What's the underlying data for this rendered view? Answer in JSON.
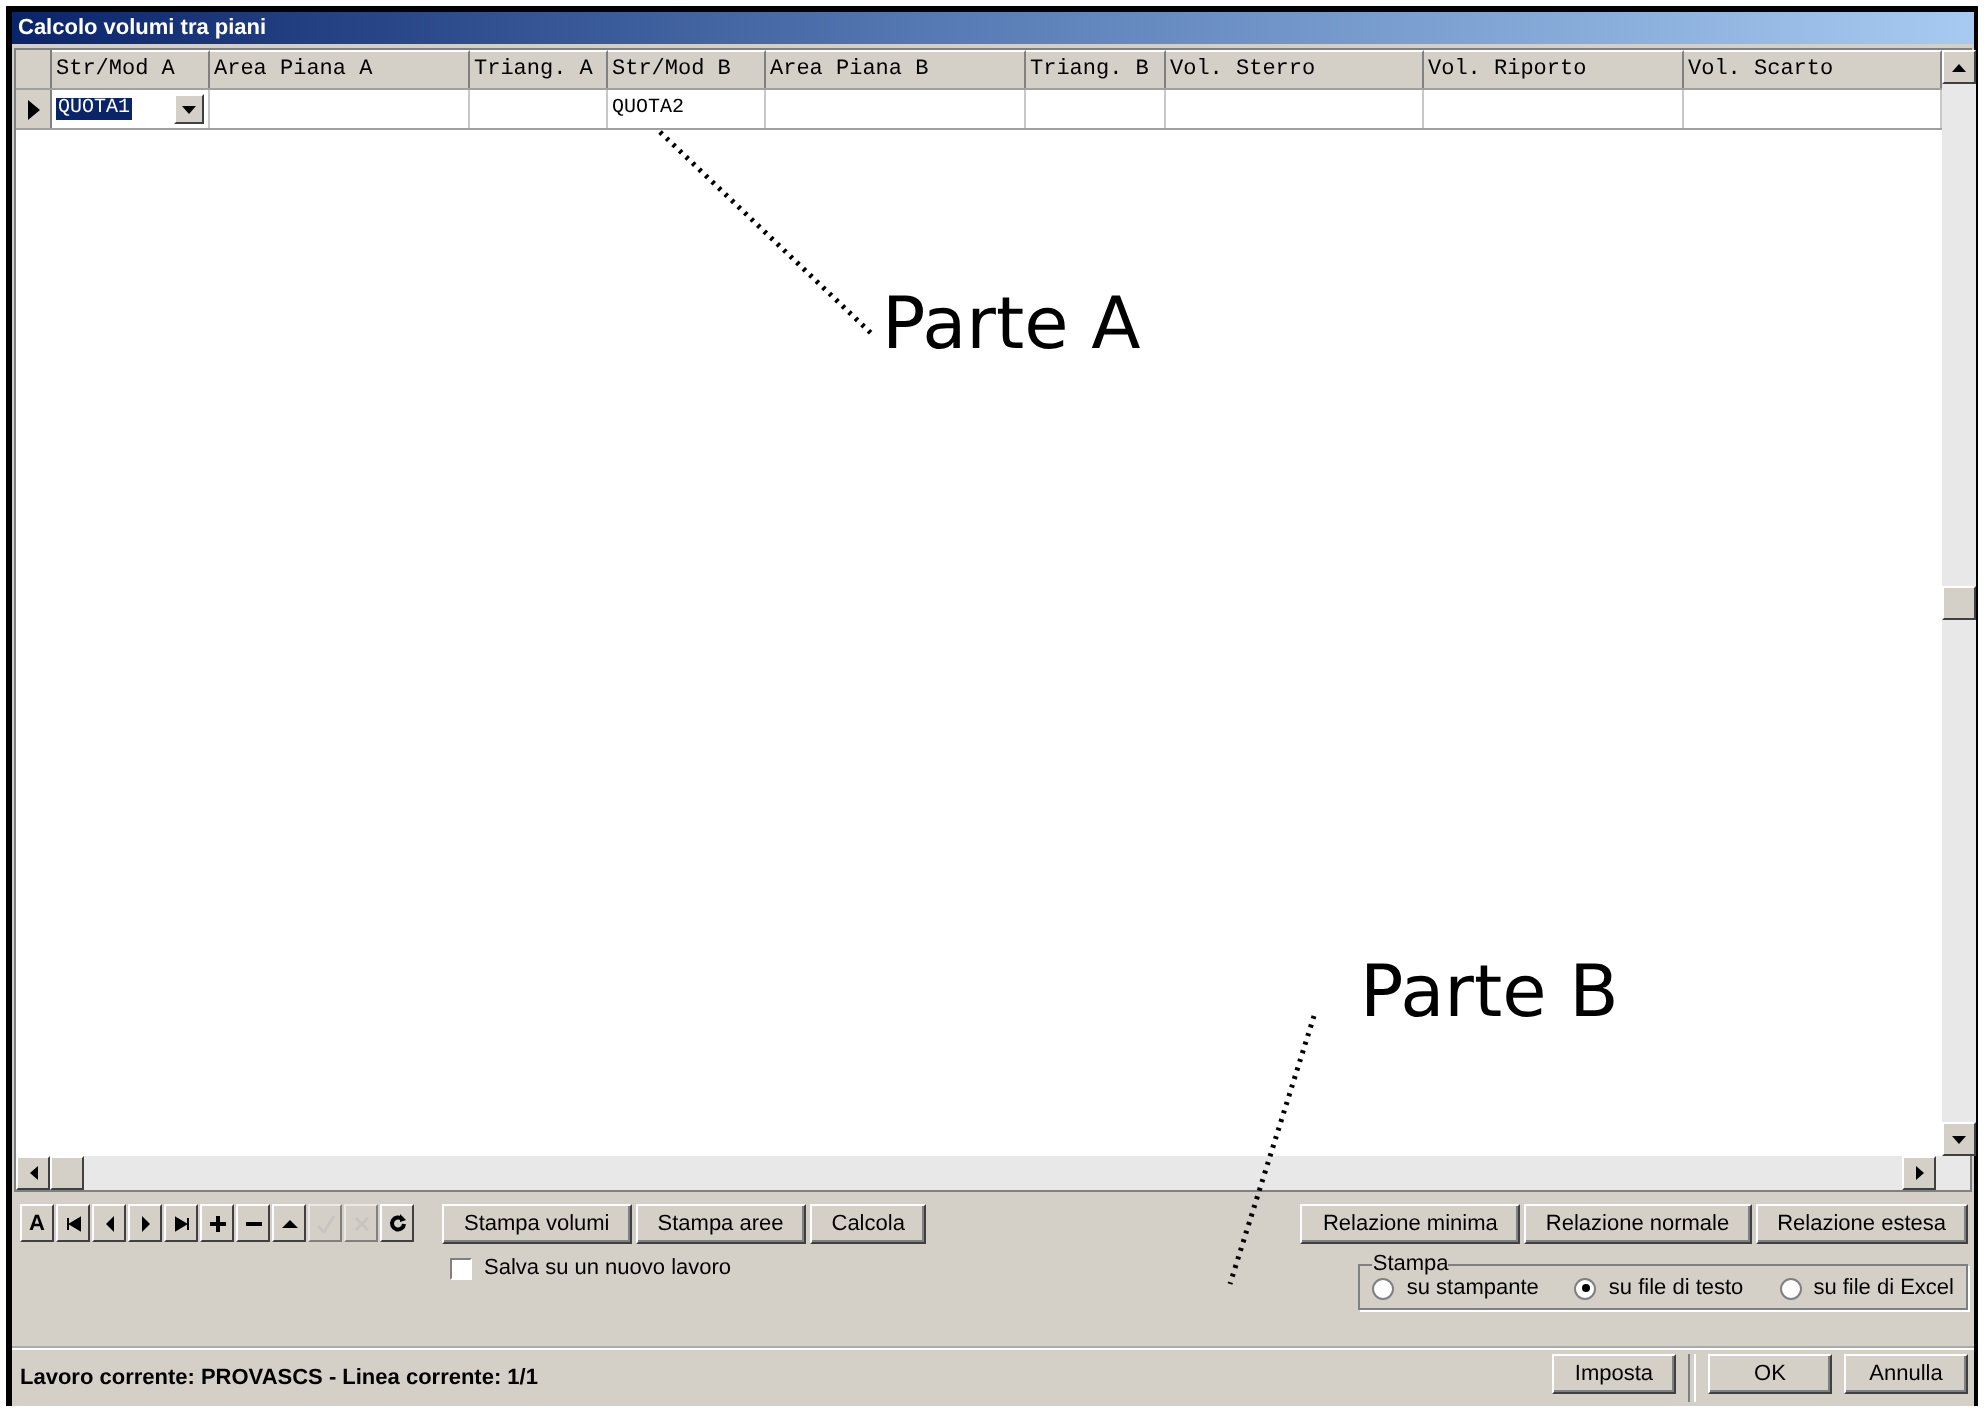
{
  "window": {
    "title": "Calcolo volumi tra piani"
  },
  "table": {
    "columns": [
      "Str/Mod A",
      "Area Piana A",
      "Triang. A",
      "Str/Mod B",
      "Area Piana B",
      "Triang. B",
      "Vol. Sterro",
      "Vol. Riporto",
      "Vol. Scarto"
    ],
    "rows": [
      {
        "selected": true,
        "cells": [
          "QUOTA1",
          "",
          "",
          "QUOTA2",
          "",
          "",
          "",
          "",
          ""
        ]
      }
    ]
  },
  "annotations": [
    {
      "label": "Parte A"
    },
    {
      "label": "Parte B"
    }
  ],
  "navigator": [
    {
      "kind": "letter",
      "label": "A",
      "disabled": false
    },
    {
      "kind": "first",
      "disabled": false
    },
    {
      "kind": "prev",
      "disabled": false
    },
    {
      "kind": "next",
      "disabled": false
    },
    {
      "kind": "last",
      "disabled": false
    },
    {
      "kind": "add",
      "disabled": false
    },
    {
      "kind": "remove",
      "disabled": false
    },
    {
      "kind": "up",
      "disabled": false
    },
    {
      "kind": "confirm",
      "disabled": true
    },
    {
      "kind": "cancel",
      "disabled": true
    },
    {
      "kind": "refresh",
      "disabled": false
    }
  ],
  "actions": [
    "Stampa volumi",
    "Stampa aree",
    "Calcola"
  ],
  "save_new": {
    "label": "Salva su un nuovo lavoro",
    "checked": false
  },
  "reports": [
    "Relazione minima",
    "Relazione normale",
    "Relazione estesa"
  ],
  "print_group": {
    "title": "Stampa",
    "options": [
      {
        "label": "su stampante",
        "selected": false
      },
      {
        "label": "su file di testo",
        "selected": true
      },
      {
        "label": "su file di Excel",
        "selected": false
      }
    ]
  },
  "status_bar": {
    "text": "Lavoro corrente: PROVASCS - Linea corrente: 1/1"
  },
  "buttons": [
    "Imposta",
    "OK",
    "Annulla"
  ]
}
